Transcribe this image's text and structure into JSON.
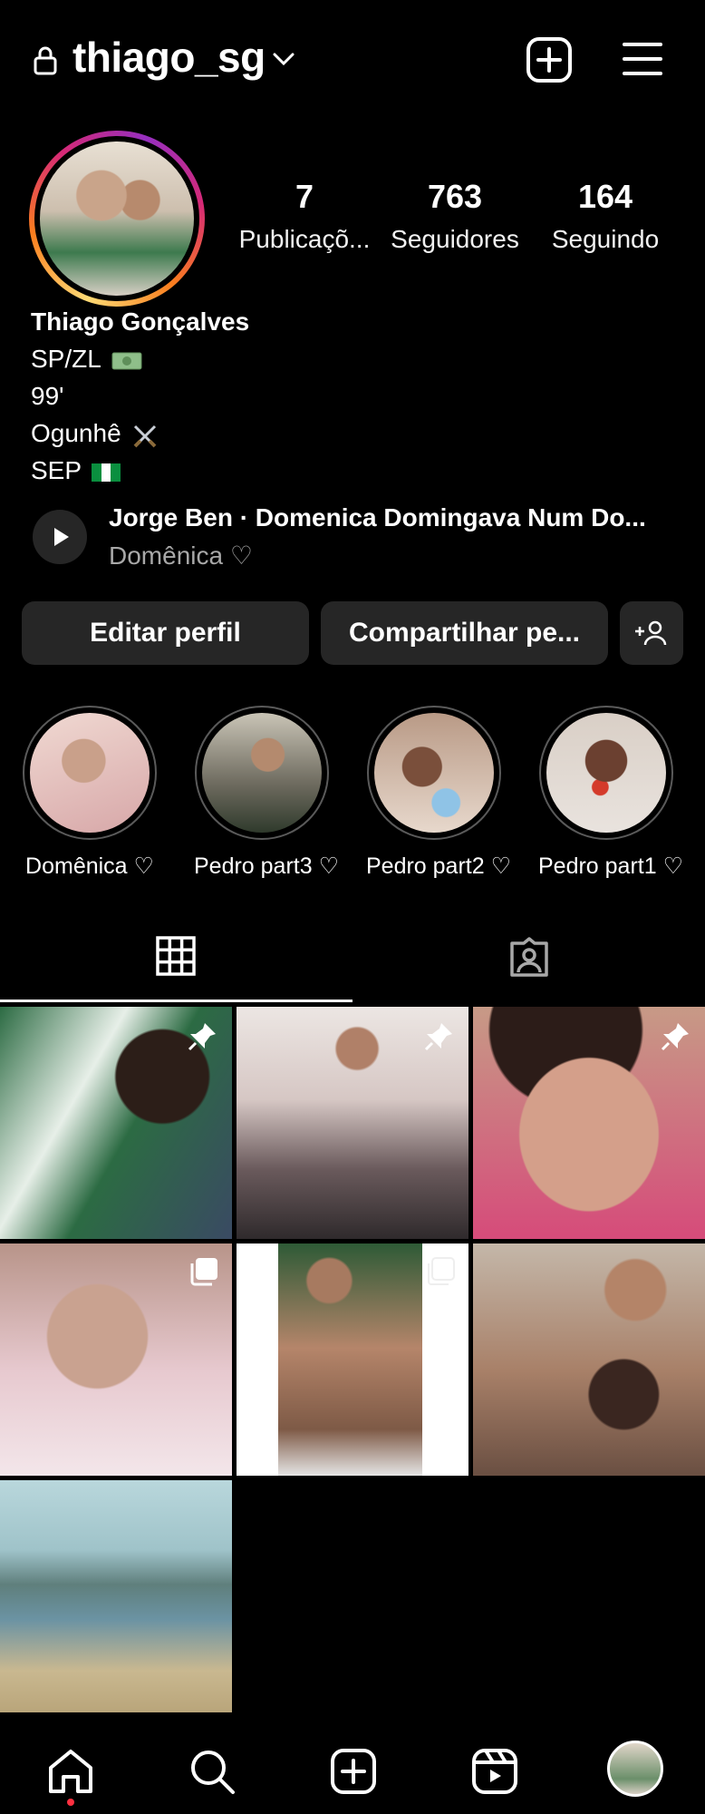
{
  "header": {
    "username": "thiago_sg",
    "icons": [
      "lock-icon",
      "chevron-down-icon",
      "add-post-icon",
      "menu-icon"
    ]
  },
  "profile": {
    "stats": [
      {
        "value": "7",
        "label": "Publicaçõ..."
      },
      {
        "value": "763",
        "label": "Seguidores"
      },
      {
        "value": "164",
        "label": "Seguindo"
      }
    ],
    "bio": {
      "name": "Thiago Gonçalves",
      "line1": "SP/ZL",
      "line2": "99'",
      "line3": "Ogunhê",
      "line4": "SEP",
      "emojis": [
        "money-emoji",
        "crossed-swords-emoji",
        "nigeria-flag-emoji"
      ]
    },
    "music": {
      "title": "Jorge Ben · Domenica Domingava Num Do...",
      "subtitle": "Domênica ♡"
    }
  },
  "actions": {
    "edit": "Editar perfil",
    "share": "Compartilhar pe...",
    "add_icon": "add-person-icon"
  },
  "highlights": [
    {
      "label": "Domênica ♡",
      "color": "#d8b8b0"
    },
    {
      "label": "Pedro part3 ♡",
      "color": "#8a8f7a"
    },
    {
      "label": "Pedro part2 ♡",
      "color": "#8fb6cc"
    },
    {
      "label": "Pedro part1 ♡",
      "color": "#b08a70"
    }
  ],
  "tabs": [
    {
      "name": "grid-icon",
      "active": true
    },
    {
      "name": "tagged-icon",
      "active": false
    }
  ],
  "posts": [
    {
      "desc": "green and white flags crowd",
      "pinned": true,
      "multi": false,
      "color1": "#2c6b43",
      "color2": "#2d3a4f"
    },
    {
      "desc": "family in kitchen",
      "pinned": true,
      "multi": false,
      "color1": "#d9c7c2",
      "color2": "#5c4a4a"
    },
    {
      "desc": "smiling baby close up",
      "pinned": true,
      "multi": false,
      "color1": "#c79a86",
      "color2": "#7a5548"
    },
    {
      "desc": "sleeping baby pink blanket",
      "pinned": false,
      "multi": true,
      "color1": "#e7c9cf",
      "color2": "#b89489"
    },
    {
      "desc": "tattooed man shirtless",
      "pinned": false,
      "multi": true,
      "color1": "#2e5a36",
      "color2": "#b5856a"
    },
    {
      "desc": "man holding child",
      "pinned": false,
      "multi": false,
      "color1": "#c4b7a9",
      "color2": "#6a4f42"
    },
    {
      "desc": "beach landscape",
      "pinned": false,
      "multi": false,
      "color1": "#9fc3c9",
      "color2": "#c9b890"
    }
  ],
  "nav": [
    "home-icon",
    "search-icon",
    "create-icon",
    "reels-icon",
    "profile-avatar"
  ],
  "colors": {
    "background": "#000000",
    "button": "#262626",
    "muted": "#a8a8a8",
    "notify": "#ff3040"
  }
}
